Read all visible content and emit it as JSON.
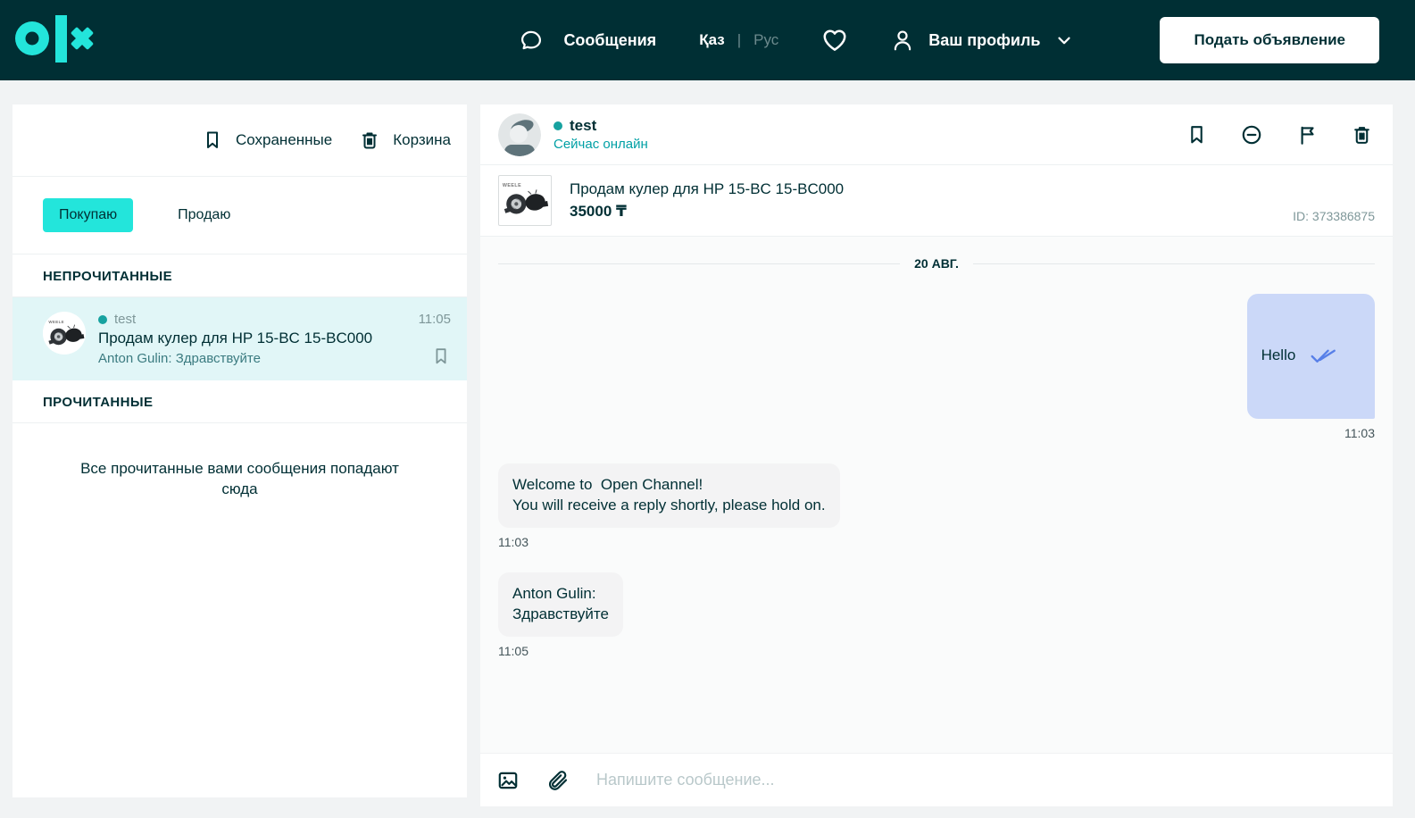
{
  "header": {
    "messages_label": "Сообщения",
    "lang_kaz": "Қаз",
    "lang_separator": "|",
    "lang_rus": "Рус",
    "profile_label": "Ваш профиль",
    "post_ad_button": "Подать объявление"
  },
  "sidebar": {
    "saved_label": "Сохраненные",
    "trash_label": "Корзина",
    "tabs": {
      "buying": "Покупаю",
      "selling": "Продаю"
    },
    "sections": {
      "unread": "НЕПРОЧИТАННЫЕ",
      "read": "ПРОЧИТАННЫЕ"
    },
    "conversation": {
      "name": "test",
      "title": "Продам кулер для HP 15-BC 15-BC000",
      "last_message": "Anton Gulin: Здравствуйте",
      "time": "11:05"
    },
    "read_empty_text": "Все прочитанные вами сообщения попадают сюда"
  },
  "chat": {
    "peer_name": "test",
    "peer_status": "Сейчас онлайн",
    "product": {
      "title": "Продам кулер для HP 15-BC 15-BC000",
      "price": "35000 ₸",
      "id_label": "ID: 373386875"
    },
    "date_divider": "20 АВГ.",
    "messages": [
      {
        "direction": "out",
        "text": "Hello",
        "time": "11:03",
        "status": "read"
      },
      {
        "direction": "in",
        "text": "Welcome to  Open Channel!\nYou will receive a reply shortly, please hold on.",
        "time": "11:03"
      },
      {
        "direction": "in",
        "text": "Anton Gulin:\nЗдравствуйте",
        "time": "11:05"
      }
    ],
    "composer_placeholder": "Напишите сообщение..."
  },
  "icons": [
    "olx-logo",
    "chat-bubble-icon",
    "heart-icon",
    "person-icon",
    "chevron-down-icon",
    "bookmark-icon",
    "trash-icon",
    "block-icon",
    "flag-icon",
    "image-icon",
    "paperclip-icon",
    "double-check-icon",
    "online-dot"
  ],
  "colors": {
    "header_bg": "#002F34",
    "brand_accent": "#23E5DB",
    "text_dark": "#002F34",
    "status_online": "#00A0A5",
    "unread_item_bg": "#E1F6F7",
    "outgoing_bubble": "#CBD8F8",
    "incoming_bubble": "#F3F3F4",
    "check_blue": "#577FE8",
    "muted_gray": "#7E9799"
  }
}
